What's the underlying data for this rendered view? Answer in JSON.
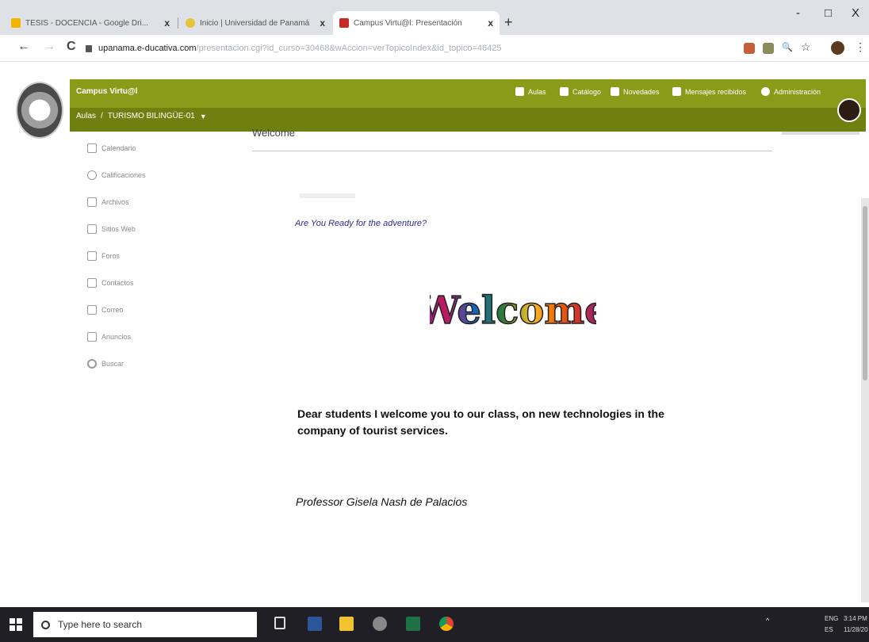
{
  "browser": {
    "tabs": [
      {
        "title": "TESIS - DOCENCIA - Google Dri...",
        "close": "x",
        "favicon_color": "#f4b400",
        "active": false
      },
      {
        "title": "Inicio | Universidad de Panamá",
        "close": "x",
        "favicon_color": "#e8c23a",
        "active": false
      },
      {
        "title": "Campus Virtu@l: Presentación",
        "close": "x",
        "favicon_color": "#c62828",
        "active": true
      }
    ],
    "new_tab": "+",
    "window_controls": {
      "minimize": "-",
      "maximize": "□",
      "close": "X"
    },
    "nav": {
      "back": "←",
      "forward": "→",
      "reload": "C"
    },
    "address": {
      "host": "upanama.e-ducativa.com",
      "path": "/presentacion.cgi?id_curso=30468&wAccion=verTopicoIndex&id_topico=46425"
    },
    "toolbar_icons": {
      "search": "🔍",
      "star": "☆",
      "menu": "⋮"
    }
  },
  "app": {
    "brand": "Campus Virtu@l",
    "breadcrumb": {
      "home": "Aulas",
      "separator": "/",
      "course": "TURISMO BILINGÜE-01",
      "caret": "▼"
    },
    "topnav": [
      "Aulas",
      "Catálogo",
      "Novedades",
      "Mensajes recibidos",
      "Administración"
    ],
    "accent_color": "#8a9b1a"
  },
  "sidebar": {
    "items": [
      {
        "label": "Calendario",
        "icon": "calendar-icon"
      },
      {
        "label": "Calificaciones",
        "icon": "grades-icon"
      },
      {
        "label": "Archivos",
        "icon": "folder-icon"
      },
      {
        "label": "Sitios Web",
        "icon": "link-icon"
      },
      {
        "label": "Foros",
        "icon": "forum-icon"
      },
      {
        "label": "Contactos",
        "icon": "contacts-icon"
      },
      {
        "label": "Correo",
        "icon": "mail-icon"
      },
      {
        "label": "Anuncios",
        "icon": "announcement-icon"
      },
      {
        "label": "Buscar",
        "icon": "search-icon"
      }
    ]
  },
  "main": {
    "heading": "Welcome",
    "adventure": "Are You Ready for the adventure?",
    "welcome_art": "Welcome",
    "message": "Dear students I welcome you to our class, on new technologies in the company of tourist services.",
    "signature": "Professor Gisela Nash de Palacios"
  },
  "taskbar": {
    "search_placeholder": "Type here to search",
    "tray": {
      "chevron": "^",
      "lang": "ENG",
      "region": "ES",
      "time": "3:14 PM",
      "date": "11/28/20"
    }
  }
}
